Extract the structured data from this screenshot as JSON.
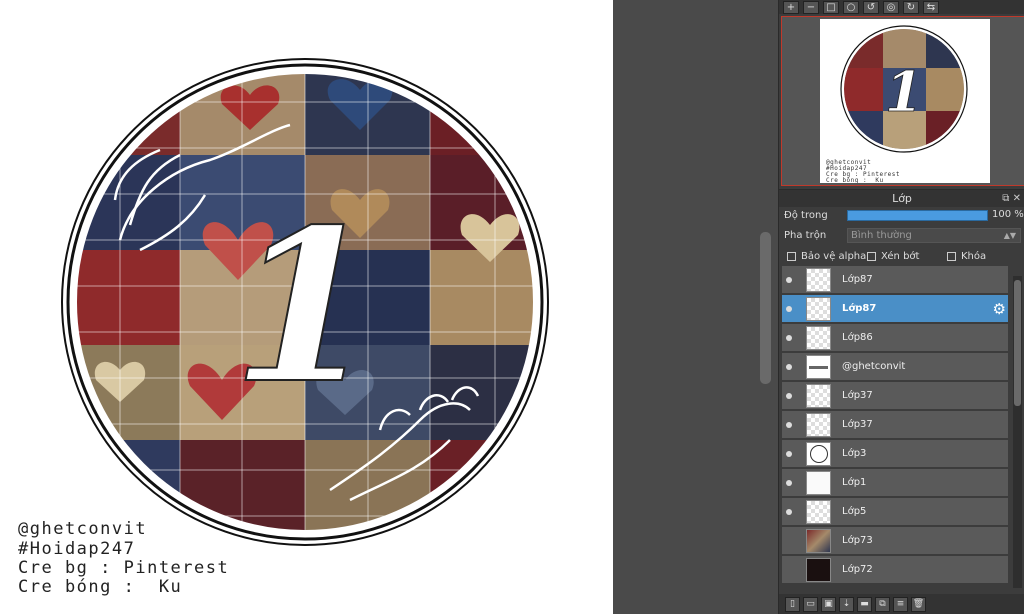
{
  "canvas": {
    "artwork": {
      "numeral": "1"
    },
    "credits": [
      "@ghetconvit",
      "#Hoidap247",
      "Cre bg : Pinterest",
      "Cre bóng :  Ku"
    ]
  },
  "toolbar_top": {
    "icons": [
      "zoom-in-icon",
      "zoom-out-icon",
      "fit-icon",
      "zoom-100-icon",
      "rotate-left-icon",
      "reset-icon",
      "rotate-right-icon",
      "flip-icon"
    ]
  },
  "layers_panel": {
    "title": "Lớp",
    "opacity_label": "Độ trong",
    "opacity_value": "100 %",
    "opacity_fraction": 1.0,
    "blend_label": "Pha trộn",
    "blend_value": "Bình thường",
    "checkboxes": {
      "protect_alpha": "Bảo vệ alpha",
      "clipping": "Xén bớt",
      "lock": "Khóa"
    },
    "layers": [
      {
        "name": "Lớp87",
        "visible": true,
        "selected": false,
        "thumb": "checker"
      },
      {
        "name": "Lớp87",
        "visible": true,
        "selected": true,
        "thumb": "checker"
      },
      {
        "name": "Lớp86",
        "visible": true,
        "selected": false,
        "thumb": "checker"
      },
      {
        "name": "@ghetconvit",
        "visible": true,
        "selected": false,
        "thumb": "text"
      },
      {
        "name": "Lớp37",
        "visible": true,
        "selected": false,
        "thumb": "checker"
      },
      {
        "name": "Lớp37",
        "visible": true,
        "selected": false,
        "thumb": "checker"
      },
      {
        "name": "Lớp3",
        "visible": true,
        "selected": false,
        "thumb": "circle"
      },
      {
        "name": "Lớp1",
        "visible": true,
        "selected": false,
        "thumb": "white"
      },
      {
        "name": "Lớp5",
        "visible": true,
        "selected": false,
        "thumb": "checker"
      },
      {
        "name": "Lớp73",
        "visible": false,
        "selected": false,
        "thumb": "quilt"
      },
      {
        "name": "Lớp72",
        "visible": false,
        "selected": false,
        "thumb": "dark"
      }
    ]
  },
  "colors": {
    "selected_layer": "#4a8fc7",
    "navigator_border": "#c0392b",
    "opacity_bar": "#4a9be0"
  }
}
